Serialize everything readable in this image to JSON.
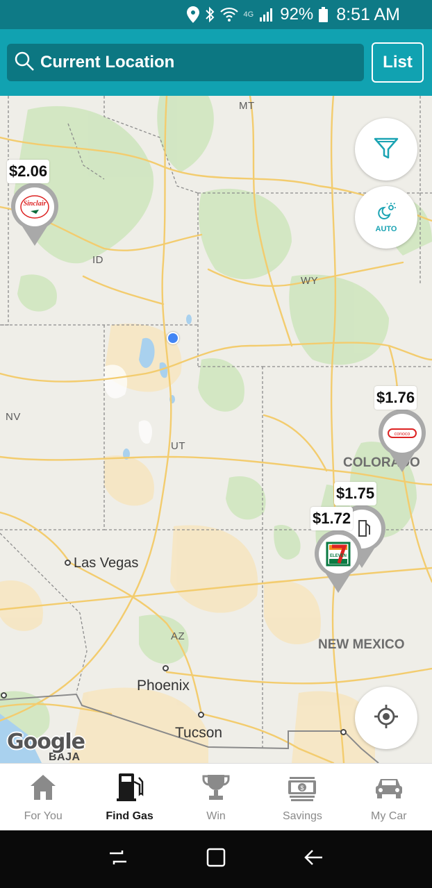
{
  "status_bar": {
    "battery": "92%",
    "time": "8:51 AM",
    "network": "4G"
  },
  "header": {
    "search_label": "Current Location",
    "list_button": "List"
  },
  "map": {
    "state_labels": [
      {
        "name": "MT"
      },
      {
        "name": "ID"
      },
      {
        "name": "WY"
      },
      {
        "name": "NV"
      },
      {
        "name": "UT"
      },
      {
        "name": "AZ"
      }
    ],
    "region_labels": {
      "colorado": "COLORADO",
      "new_mexico": "NEW MEXICO",
      "baja": "BAJA"
    },
    "cities": {
      "las_vegas": "Las Vegas",
      "phoenix": "Phoenix",
      "tucson": "Tucson"
    },
    "filter_button_icon": "funnel-icon",
    "auto_mode_label": "AUTO",
    "recenter_icon": "crosshair-icon",
    "attribution": "Google"
  },
  "price_pins": [
    {
      "price": "$2.06",
      "brand": "Sinclair"
    },
    {
      "price": "$1.76",
      "brand": "conoco"
    },
    {
      "price": "$1.75",
      "brand": "pump"
    },
    {
      "price": "$1.72",
      "brand": "7 ELEVEN"
    }
  ],
  "bottom_nav": [
    {
      "label": "For You",
      "icon": "home-icon",
      "active": false
    },
    {
      "label": "Find Gas",
      "icon": "gas-pump-icon",
      "active": true
    },
    {
      "label": "Win",
      "icon": "trophy-icon",
      "active": false
    },
    {
      "label": "Savings",
      "icon": "money-icon",
      "active": false
    },
    {
      "label": "My Car",
      "icon": "car-icon",
      "active": false
    }
  ],
  "colors": {
    "header": "#11a2b1",
    "status_bar": "#0e7a86",
    "accent": "#1aa3b3"
  }
}
